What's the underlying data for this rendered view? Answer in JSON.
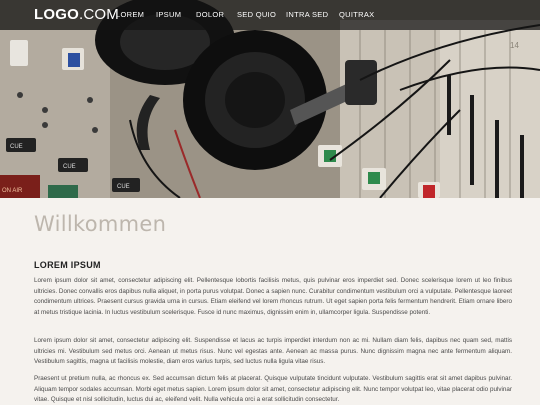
{
  "logo": {
    "strong": "LOGO",
    "light": ".COM"
  },
  "nav": {
    "items": [
      {
        "label": "LOREM",
        "key": "lorem"
      },
      {
        "label": "IPSUM",
        "key": "ipsum"
      },
      {
        "label": "DOLOR",
        "key": "dolor"
      },
      {
        "label": "SED QUIO",
        "key": "sed-quio"
      },
      {
        "label": "INTRA SED",
        "key": "intra-sed"
      },
      {
        "label": "QUITRAX",
        "key": "quitrax"
      }
    ]
  },
  "hero": {
    "panel_labels": {
      "cue1": "CUE",
      "cue2": "CUE",
      "cue3": "CUE",
      "on_air": "ON AIR",
      "n14": "14"
    }
  },
  "main": {
    "welcome": "Willkommen",
    "section_title": "LOREM IPSUM",
    "paragraphs": [
      "Lorem ipsum dolor sit amet, consectetur adipiscing elit. Pellentesque lobortis facilisis metus, quis pulvinar eros imperdiet sed. Donec scelerisque lorem ut leo finibus ultricies. Donec convallis eros dapibus nulla aliquet, in porta purus volutpat. Donec a sapien nunc. Curabitur condimentum vestibulum orci a vulputate. Pellentesque laoreet condimentum ultrices. Praesent cursus gravida urna in cursus. Etiam eleifend vel lorem rhoncus rutrum. Ut eget sapien porta felis fermentum hendrerit. Etiam ornare libero at metus tristique lacinia. In luctus vestibulum scelerisque. Fusce id nunc maximus, dignissim enim in, ullamcorper ligula. Suspendisse potenti.",
      "Lorem ipsum dolor sit amet, consectetur adipiscing elit. Suspendisse et lacus ac turpis imperdiet interdum non ac mi. Nullam diam felis, dapibus nec quam sed, mattis ultricies mi. Vestibulum sed metus orci. Aenean ut metus risus. Nunc vel egestas ante. Aenean ac massa purus. Nunc dignissim magna nec ante fermentum aliquam. Vestibulum sagittis, magna ut facilisis molestie, diam eros varius turpis, sed luctus nulla ligula vitae risus.",
      "Praesent ut pretium nulla, ac rhoncus ex. Sed accumsan dictum felis at placerat. Quisque vulputate tincidunt vulputate. Vestibulum sagittis erat sit amet dapibus pulvinar. Aliquam tempor sodales accumsan. Morbi eget metus sapien. Lorem ipsum dolor sit amet, consectetur adipiscing elit. Nunc tempor volutpat leo, vitae placerat odio pulvinar vitae. Quisque et nisl sollicitudin, luctus dui ac, eleifend velit. Nulla vehicula orci a erat sollicitudin consectetur."
    ]
  },
  "colors": {
    "nav_bg": "#141414",
    "page_bg": "#f5f2ee",
    "welcome_text": "#bdb6ad",
    "body_text": "#4a4a4a"
  }
}
